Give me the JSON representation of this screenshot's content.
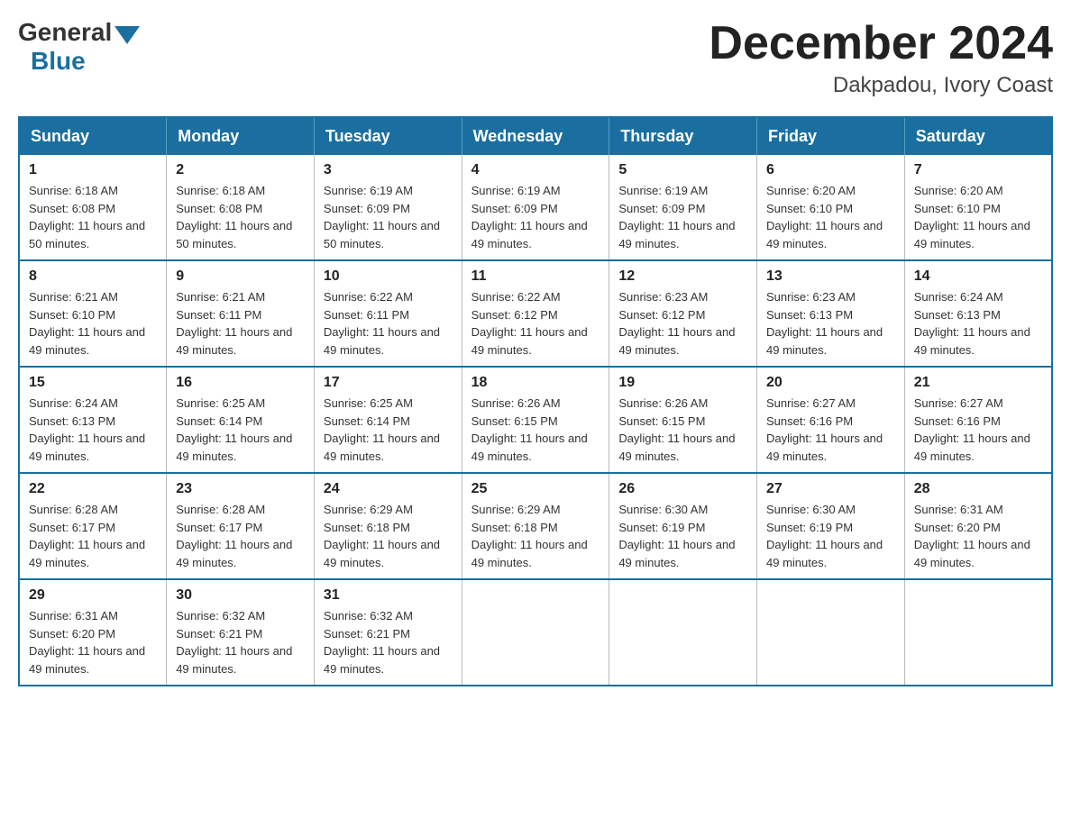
{
  "logo": {
    "text_general": "General",
    "text_blue": "Blue"
  },
  "title": {
    "month_year": "December 2024",
    "location": "Dakpadou, Ivory Coast"
  },
  "days_of_week": [
    "Sunday",
    "Monday",
    "Tuesday",
    "Wednesday",
    "Thursday",
    "Friday",
    "Saturday"
  ],
  "weeks": [
    [
      {
        "day": "1",
        "sunrise": "Sunrise: 6:18 AM",
        "sunset": "Sunset: 6:08 PM",
        "daylight": "Daylight: 11 hours and 50 minutes."
      },
      {
        "day": "2",
        "sunrise": "Sunrise: 6:18 AM",
        "sunset": "Sunset: 6:08 PM",
        "daylight": "Daylight: 11 hours and 50 minutes."
      },
      {
        "day": "3",
        "sunrise": "Sunrise: 6:19 AM",
        "sunset": "Sunset: 6:09 PM",
        "daylight": "Daylight: 11 hours and 50 minutes."
      },
      {
        "day": "4",
        "sunrise": "Sunrise: 6:19 AM",
        "sunset": "Sunset: 6:09 PM",
        "daylight": "Daylight: 11 hours and 49 minutes."
      },
      {
        "day": "5",
        "sunrise": "Sunrise: 6:19 AM",
        "sunset": "Sunset: 6:09 PM",
        "daylight": "Daylight: 11 hours and 49 minutes."
      },
      {
        "day": "6",
        "sunrise": "Sunrise: 6:20 AM",
        "sunset": "Sunset: 6:10 PM",
        "daylight": "Daylight: 11 hours and 49 minutes."
      },
      {
        "day": "7",
        "sunrise": "Sunrise: 6:20 AM",
        "sunset": "Sunset: 6:10 PM",
        "daylight": "Daylight: 11 hours and 49 minutes."
      }
    ],
    [
      {
        "day": "8",
        "sunrise": "Sunrise: 6:21 AM",
        "sunset": "Sunset: 6:10 PM",
        "daylight": "Daylight: 11 hours and 49 minutes."
      },
      {
        "day": "9",
        "sunrise": "Sunrise: 6:21 AM",
        "sunset": "Sunset: 6:11 PM",
        "daylight": "Daylight: 11 hours and 49 minutes."
      },
      {
        "day": "10",
        "sunrise": "Sunrise: 6:22 AM",
        "sunset": "Sunset: 6:11 PM",
        "daylight": "Daylight: 11 hours and 49 minutes."
      },
      {
        "day": "11",
        "sunrise": "Sunrise: 6:22 AM",
        "sunset": "Sunset: 6:12 PM",
        "daylight": "Daylight: 11 hours and 49 minutes."
      },
      {
        "day": "12",
        "sunrise": "Sunrise: 6:23 AM",
        "sunset": "Sunset: 6:12 PM",
        "daylight": "Daylight: 11 hours and 49 minutes."
      },
      {
        "day": "13",
        "sunrise": "Sunrise: 6:23 AM",
        "sunset": "Sunset: 6:13 PM",
        "daylight": "Daylight: 11 hours and 49 minutes."
      },
      {
        "day": "14",
        "sunrise": "Sunrise: 6:24 AM",
        "sunset": "Sunset: 6:13 PM",
        "daylight": "Daylight: 11 hours and 49 minutes."
      }
    ],
    [
      {
        "day": "15",
        "sunrise": "Sunrise: 6:24 AM",
        "sunset": "Sunset: 6:13 PM",
        "daylight": "Daylight: 11 hours and 49 minutes."
      },
      {
        "day": "16",
        "sunrise": "Sunrise: 6:25 AM",
        "sunset": "Sunset: 6:14 PM",
        "daylight": "Daylight: 11 hours and 49 minutes."
      },
      {
        "day": "17",
        "sunrise": "Sunrise: 6:25 AM",
        "sunset": "Sunset: 6:14 PM",
        "daylight": "Daylight: 11 hours and 49 minutes."
      },
      {
        "day": "18",
        "sunrise": "Sunrise: 6:26 AM",
        "sunset": "Sunset: 6:15 PM",
        "daylight": "Daylight: 11 hours and 49 minutes."
      },
      {
        "day": "19",
        "sunrise": "Sunrise: 6:26 AM",
        "sunset": "Sunset: 6:15 PM",
        "daylight": "Daylight: 11 hours and 49 minutes."
      },
      {
        "day": "20",
        "sunrise": "Sunrise: 6:27 AM",
        "sunset": "Sunset: 6:16 PM",
        "daylight": "Daylight: 11 hours and 49 minutes."
      },
      {
        "day": "21",
        "sunrise": "Sunrise: 6:27 AM",
        "sunset": "Sunset: 6:16 PM",
        "daylight": "Daylight: 11 hours and 49 minutes."
      }
    ],
    [
      {
        "day": "22",
        "sunrise": "Sunrise: 6:28 AM",
        "sunset": "Sunset: 6:17 PM",
        "daylight": "Daylight: 11 hours and 49 minutes."
      },
      {
        "day": "23",
        "sunrise": "Sunrise: 6:28 AM",
        "sunset": "Sunset: 6:17 PM",
        "daylight": "Daylight: 11 hours and 49 minutes."
      },
      {
        "day": "24",
        "sunrise": "Sunrise: 6:29 AM",
        "sunset": "Sunset: 6:18 PM",
        "daylight": "Daylight: 11 hours and 49 minutes."
      },
      {
        "day": "25",
        "sunrise": "Sunrise: 6:29 AM",
        "sunset": "Sunset: 6:18 PM",
        "daylight": "Daylight: 11 hours and 49 minutes."
      },
      {
        "day": "26",
        "sunrise": "Sunrise: 6:30 AM",
        "sunset": "Sunset: 6:19 PM",
        "daylight": "Daylight: 11 hours and 49 minutes."
      },
      {
        "day": "27",
        "sunrise": "Sunrise: 6:30 AM",
        "sunset": "Sunset: 6:19 PM",
        "daylight": "Daylight: 11 hours and 49 minutes."
      },
      {
        "day": "28",
        "sunrise": "Sunrise: 6:31 AM",
        "sunset": "Sunset: 6:20 PM",
        "daylight": "Daylight: 11 hours and 49 minutes."
      }
    ],
    [
      {
        "day": "29",
        "sunrise": "Sunrise: 6:31 AM",
        "sunset": "Sunset: 6:20 PM",
        "daylight": "Daylight: 11 hours and 49 minutes."
      },
      {
        "day": "30",
        "sunrise": "Sunrise: 6:32 AM",
        "sunset": "Sunset: 6:21 PM",
        "daylight": "Daylight: 11 hours and 49 minutes."
      },
      {
        "day": "31",
        "sunrise": "Sunrise: 6:32 AM",
        "sunset": "Sunset: 6:21 PM",
        "daylight": "Daylight: 11 hours and 49 minutes."
      },
      null,
      null,
      null,
      null
    ]
  ]
}
